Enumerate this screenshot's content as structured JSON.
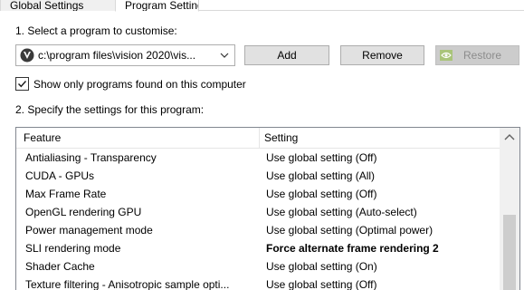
{
  "tabs": [
    {
      "label": "Global Settings"
    },
    {
      "label": "Program Settings"
    }
  ],
  "step1": {
    "label": "1. Select a program to customise:"
  },
  "program_select": {
    "value": "c:\\program files\\vision 2020\\vis...",
    "icon": "vision-app-icon"
  },
  "buttons": {
    "add": "Add",
    "remove": "Remove",
    "restore": "Restore"
  },
  "checkbox": {
    "label": "Show only programs found on this computer",
    "checked": true
  },
  "step2": {
    "label": "2. Specify the settings for this program:"
  },
  "table": {
    "headers": {
      "feature": "Feature",
      "setting": "Setting"
    },
    "rows": [
      {
        "feature": "Antialiasing - Transparency",
        "setting": "Use global setting (Off)"
      },
      {
        "feature": "CUDA - GPUs",
        "setting": "Use global setting (All)"
      },
      {
        "feature": "Max Frame Rate",
        "setting": "Use global setting (Off)"
      },
      {
        "feature": "OpenGL rendering GPU",
        "setting": "Use global setting (Auto-select)"
      },
      {
        "feature": "Power management mode",
        "setting": "Use global setting (Optimal power)"
      },
      {
        "feature": "SLI rendering mode",
        "setting": "Force alternate frame rendering 2"
      },
      {
        "feature": "Shader Cache",
        "setting": "Use global setting (On)"
      },
      {
        "feature": "Texture filtering - Anisotropic sample opti...",
        "setting": "Use global setting (Off)"
      }
    ]
  },
  "colors": {
    "button_bg": "#e1e1e1",
    "button_border": "#adadad",
    "disabled_bg": "#cccccc",
    "nvidia_green": "#76b900"
  }
}
